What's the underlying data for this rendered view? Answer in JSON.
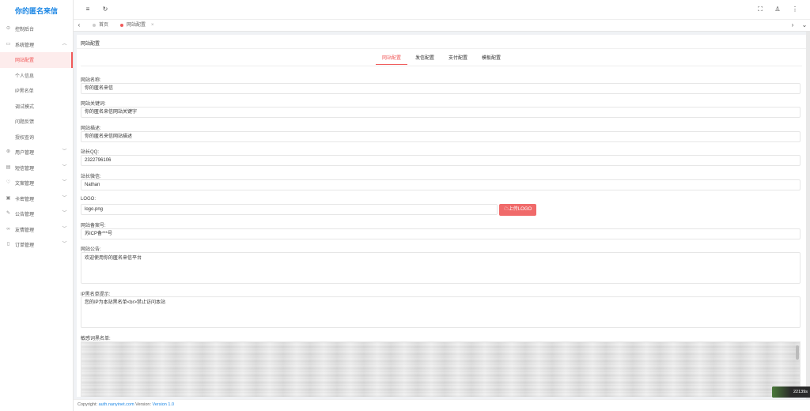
{
  "brand": "你的匿名来信",
  "sidebar": {
    "dashboard": "控制后台",
    "system": "系统管理",
    "system_children": [
      "网站配置",
      "个人信息",
      "IP黑名单",
      "调试模式",
      "问题反馈",
      "授权查询"
    ],
    "groups": [
      "用户管理",
      "短信管理",
      "文案管理",
      "卡密管理",
      "公告管理",
      "友情管理",
      "订单管理"
    ]
  },
  "tabs": {
    "home": "首页",
    "current": "网站配置",
    "close": "×"
  },
  "page": {
    "title": "网站配置",
    "config_tabs": [
      "网站配置",
      "发信配置",
      "支付配置",
      "模板配置"
    ],
    "fields": {
      "site_name": {
        "label": "网站名称:",
        "value": "你的匿名来信"
      },
      "keywords": {
        "label": "网站关键词:",
        "value": "你的匿名来信网站关键字"
      },
      "description": {
        "label": "网站描述:",
        "value": "你的匿名来信网站描述"
      },
      "qq": {
        "label": "站长QQ:",
        "value": "2322796106"
      },
      "wechat": {
        "label": "站长微信:",
        "value": "Nathan"
      },
      "logo": {
        "label": "LOGO:",
        "value": "logo.png",
        "button": "上传LOGO"
      },
      "icp": {
        "label": "网站备案号:",
        "value": "苏ICP备***号"
      },
      "notice": {
        "label": "网站公告:",
        "value": "欢迎使用你的匿名来信平台"
      },
      "ip_blacklist_tip": {
        "label": "IP黑名单提示:",
        "value": "您的IP为本站黑名单<br>禁止访问本站"
      },
      "sensitive_words": {
        "label": "敏感词黑名单:"
      }
    }
  },
  "badge": "22139s",
  "footer": {
    "copyright": "Copyright:",
    "site": "auth.nanyinet.com",
    "version_label": "Version:",
    "version": "Version 1.0"
  },
  "colors": {
    "accent": "#f05a5a",
    "brand": "#1e88e5"
  }
}
